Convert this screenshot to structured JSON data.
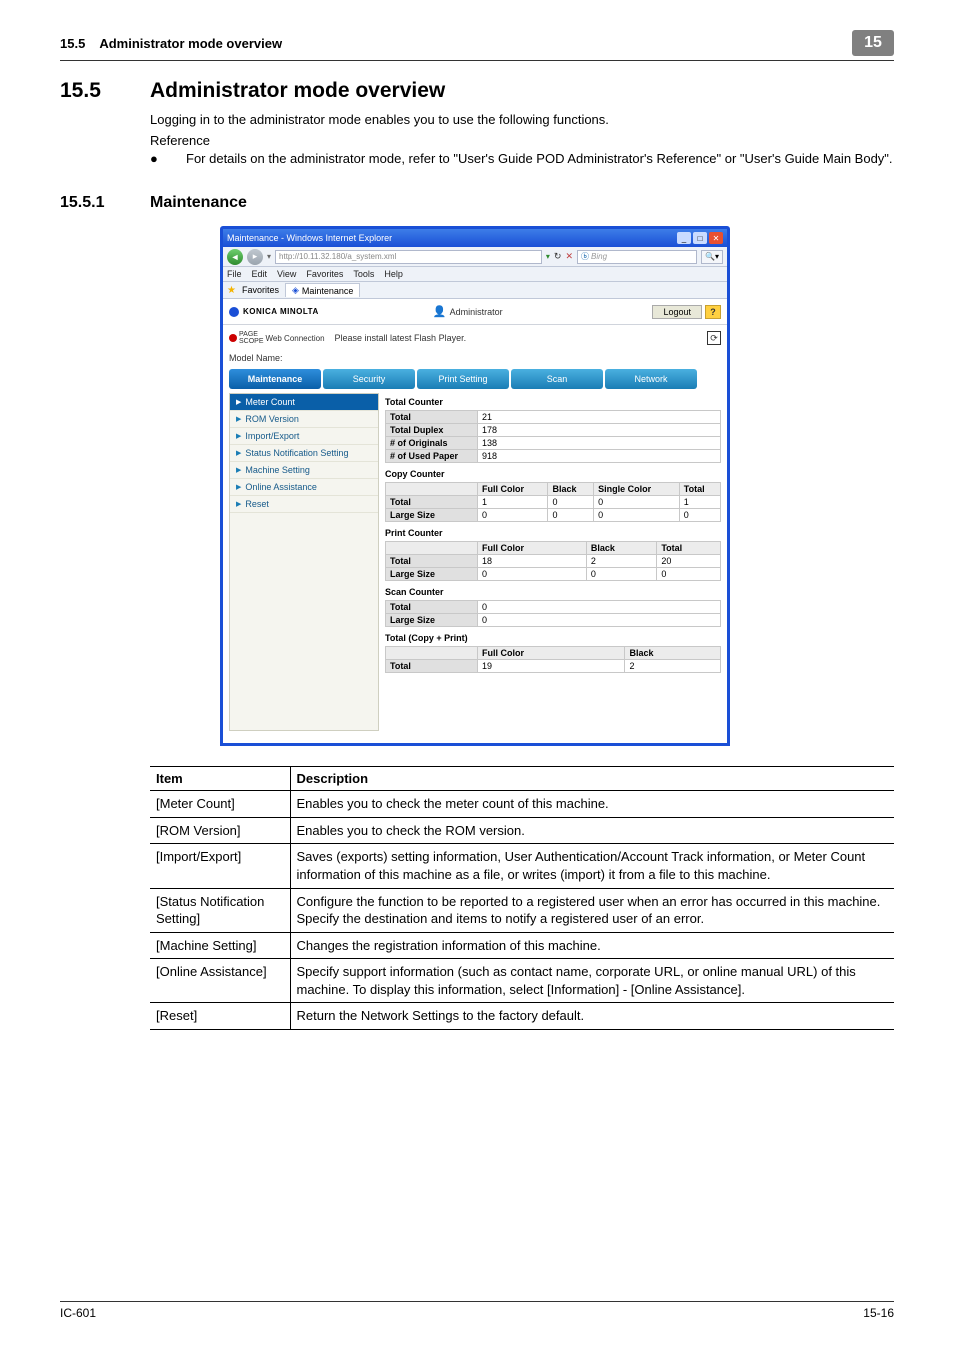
{
  "header": {
    "section": "15.5",
    "title": "Administrator mode overview",
    "tab": "15"
  },
  "h2": {
    "num": "15.5",
    "title": "Administrator mode overview"
  },
  "intro": "Logging in to the administrator mode enables you to use the following functions.",
  "reference_label": "Reference",
  "bullet": "For details on the administrator mode, refer to \"User's Guide POD Administrator's Reference\" or \"User's Guide Main Body\".",
  "h3": {
    "num": "15.5.1",
    "title": "Maintenance"
  },
  "win": {
    "title": "Maintenance - Windows Internet Explorer",
    "addr": "http://10.11.32.180/a_system.xml",
    "search_provider": "Bing",
    "menus": [
      "File",
      "Edit",
      "View",
      "Favorites",
      "Tools",
      "Help"
    ],
    "fav_label": "Favorites",
    "fav_tab": "Maintenance",
    "brand": "KONICA MINOLTA",
    "admin_label": "Administrator",
    "logout": "Logout",
    "help": "?",
    "sub_brand_ps": "PAGE\nSCOPE",
    "sub_brand": "Web Connection",
    "flash_msg": "Please install latest Flash Player.",
    "model_label": "Model Name:",
    "tabs": [
      "Maintenance",
      "Security",
      "Print Setting",
      "Scan",
      "Network"
    ],
    "side": [
      "Meter Count",
      "ROM Version",
      "Import/Export",
      "Status Notification Setting",
      "Machine Setting",
      "Online Assistance",
      "Reset"
    ],
    "panel": {
      "total_counter": {
        "title": "Total Counter",
        "rows": [
          {
            "label": "Total",
            "v": "21"
          },
          {
            "label": "Total Duplex",
            "v": "178"
          },
          {
            "label": "# of Originals",
            "v": "138"
          },
          {
            "label": "# of Used Paper",
            "v": "918"
          }
        ]
      },
      "copy_counter": {
        "title": "Copy Counter",
        "cols": [
          "",
          "Full Color",
          "Black",
          "Single Color",
          "Total"
        ],
        "rows": [
          {
            "label": "Total",
            "c": [
              "1",
              "0",
              "0",
              "1"
            ]
          },
          {
            "label": "Large Size",
            "c": [
              "0",
              "0",
              "0",
              "0"
            ]
          }
        ]
      },
      "print_counter": {
        "title": "Print Counter",
        "cols": [
          "",
          "Full Color",
          "Black",
          "Total"
        ],
        "rows": [
          {
            "label": "Total",
            "c": [
              "18",
              "2",
              "20"
            ]
          },
          {
            "label": "Large Size",
            "c": [
              "0",
              "0",
              "0"
            ]
          }
        ]
      },
      "scan_counter": {
        "title": "Scan Counter",
        "rows": [
          {
            "label": "Total",
            "v": "0"
          },
          {
            "label": "Large Size",
            "v": "0"
          }
        ]
      },
      "total_cp": {
        "title": "Total (Copy + Print)",
        "cols": [
          "",
          "Full Color",
          "Black"
        ],
        "rows": [
          {
            "label": "Total",
            "c": [
              "19",
              "2"
            ]
          }
        ]
      }
    }
  },
  "desc": {
    "cols": [
      "Item",
      "Description"
    ],
    "rows": [
      {
        "item": "[Meter Count]",
        "desc": "Enables you to check the meter count of this machine."
      },
      {
        "item": "[ROM Version]",
        "desc": "Enables you to check the ROM version."
      },
      {
        "item": "[Import/Export]",
        "desc": "Saves (exports) setting information, User Authentication/Account Track information, or Meter Count information of this machine as a file, or writes (import) it from a file to this machine."
      },
      {
        "item": "[Status Notification Setting]",
        "desc": "Configure the function to be reported to a registered user when an error has occurred in this machine. Specify the destination and items to notify a registered user of an error."
      },
      {
        "item": "[Machine Setting]",
        "desc": "Changes the registration information of this machine."
      },
      {
        "item": "[Online Assistance]",
        "desc": "Specify support information (such as contact name, corporate URL, or online manual URL) of this machine. To display this information, select [Information] - [Online Assistance]."
      },
      {
        "item": "[Reset]",
        "desc": "Return the Network Settings to the factory default."
      }
    ]
  },
  "footer": {
    "left": "IC-601",
    "right": "15-16"
  }
}
